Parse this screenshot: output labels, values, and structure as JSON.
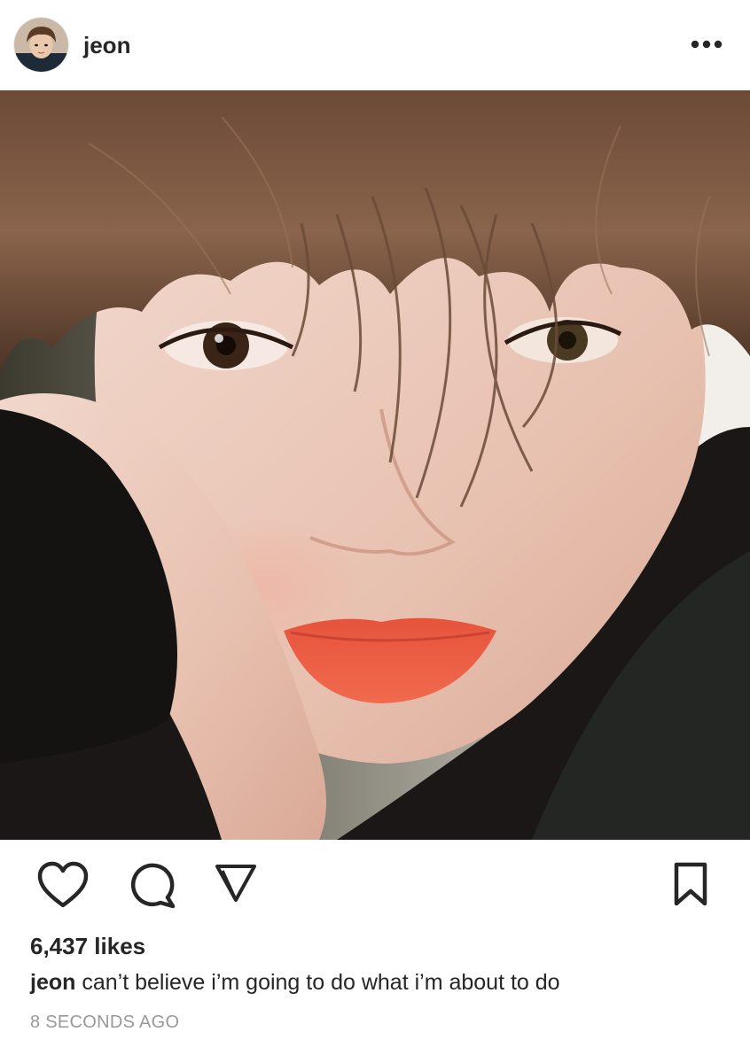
{
  "post": {
    "username": "jeon",
    "likes_text": "6,437 likes",
    "caption": {
      "username": "jeon",
      "text": "can’t believe i’m going to do what i’m about to do"
    },
    "timestamp": "8 SECONDS AGO"
  },
  "icons": {
    "more": "more-options-icon",
    "like": "heart-icon",
    "comment": "comment-bubble-icon",
    "share": "paper-plane-icon",
    "save": "bookmark-icon"
  },
  "colors": {
    "text_primary": "#262626",
    "text_secondary": "#999999",
    "background": "#ffffff"
  }
}
